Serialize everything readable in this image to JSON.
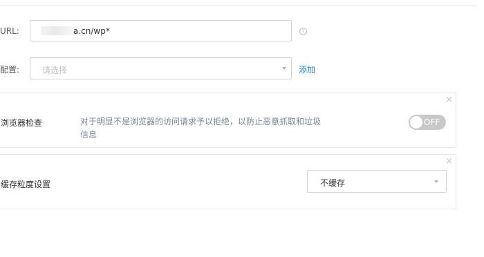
{
  "url_row": {
    "label": "URL:",
    "value": "a.cn/wp*",
    "help_icon": "question-circle-icon"
  },
  "config_row": {
    "label": "配置:",
    "placeholder": "请选择",
    "add_label": "添加"
  },
  "browser_check": {
    "title": "浏览器检查",
    "description": "对于明显不是浏览器的访问请求予以拒绝，以防止恶意抓取和垃圾信息",
    "toggle_label": "OFF",
    "toggle_on": false,
    "close_icon": "×"
  },
  "cache_setting": {
    "title": "缓存粒度设置",
    "selected": "不缓存",
    "close_icon": "×"
  },
  "colors": {
    "link": "#1e88e5",
    "toggle_off": "#c8c8c8",
    "border": "#d4d4d4"
  }
}
